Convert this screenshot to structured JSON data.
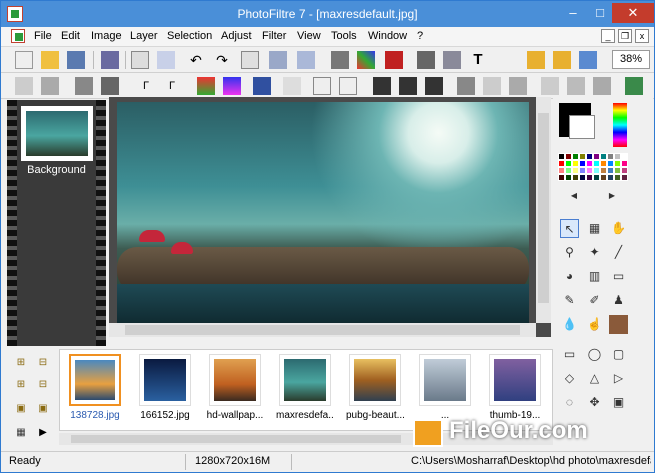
{
  "window": {
    "title": "PhotoFiltre 7 - [maxresdefault.jpg]",
    "minimize": "–",
    "maximize": "□",
    "close": "✕"
  },
  "menu": [
    "File",
    "Edit",
    "Image",
    "Layer",
    "Selection",
    "Adjust",
    "Filter",
    "View",
    "Tools",
    "Window",
    "?"
  ],
  "toolbar": {
    "zoom": "38%"
  },
  "layers": {
    "items": [
      {
        "label": "Background"
      }
    ]
  },
  "filmstrip": {
    "files": [
      {
        "name": "138728.jpg",
        "selected": true
      },
      {
        "name": "166152.jpg"
      },
      {
        "name": "hd-wallpap..."
      },
      {
        "name": "maxresdefa..."
      },
      {
        "name": "pubg-beaut..."
      },
      {
        "name": "..."
      },
      {
        "name": "thumb-19..."
      }
    ]
  },
  "status": {
    "state": "Ready",
    "dimensions": "1280x720x16M",
    "path": "C:\\Users\\Mosharraf\\Desktop\\hd photo\\maxresdefault.jj"
  },
  "watermark": {
    "text": "FileOur.com"
  },
  "colors": {
    "titlebar": "#4a8fd8",
    "close": "#c43c2c",
    "selection": "#f09020"
  }
}
